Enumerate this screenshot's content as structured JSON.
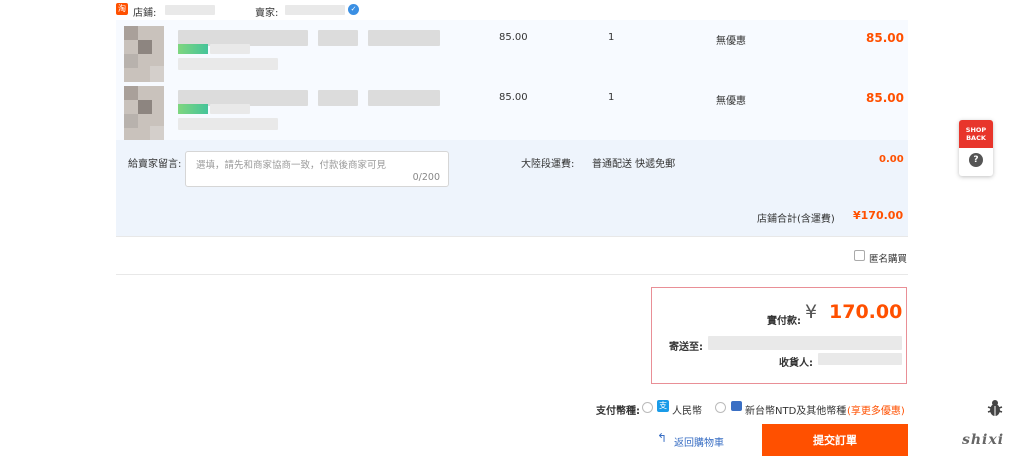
{
  "shop": {
    "logo_char": "淘",
    "shop_label": "店鋪:",
    "seller_label": "賣家:"
  },
  "items": [
    {
      "unit_price": "85.00",
      "quantity": "1",
      "discount": "無優惠",
      "subtotal": "85.00"
    },
    {
      "unit_price": "85.00",
      "quantity": "1",
      "discount": "無優惠",
      "subtotal": "85.00"
    }
  ],
  "message": {
    "label": "給賣家留言:",
    "placeholder": "選填，請先和商家協商一致，付款後商家可見",
    "counter": "0/200"
  },
  "shipping": {
    "label": "大陸段運費:",
    "method": "普通配送 快遞免郵",
    "cost": "0.00"
  },
  "shop_total": {
    "label": "店鋪合計(含運費)",
    "value": "¥170.00"
  },
  "anonymous": {
    "label": "匿名購買"
  },
  "summary": {
    "paid_label": "實付款:",
    "currency_symbol": "¥",
    "paid_value": "170.00",
    "ship_to_label": "寄送至:",
    "receiver_label": "收貨人:"
  },
  "payment": {
    "label": "支付幣種:",
    "options": [
      {
        "label": "人民幣",
        "icon": "alipay-icon"
      },
      {
        "label": "新台幣NTD及其他幣種",
        "icon": "card-icon"
      }
    ],
    "promo": "(享更多優惠)"
  },
  "actions": {
    "back_label": "返回購物車",
    "submit_label": "提交訂單"
  },
  "widget": {
    "brand_top": "SHOP",
    "brand_bottom": "BACK",
    "help_icon": "?"
  },
  "watermark": "shixi",
  "colors": {
    "accent": "#ff5000",
    "highlight_border": "#e98f96",
    "link": "#3a6fc4"
  }
}
